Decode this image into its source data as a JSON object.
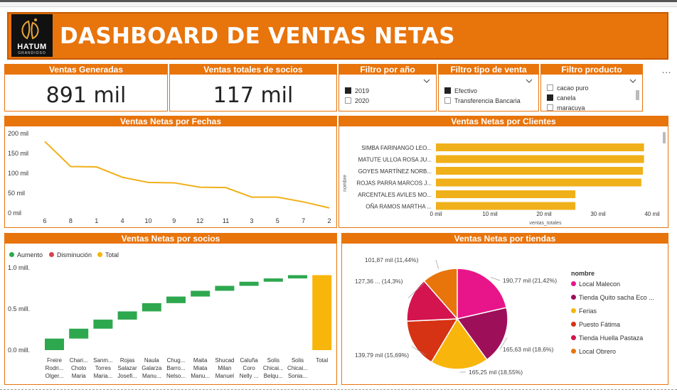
{
  "header": {
    "title": "DASHBOARD DE VENTAS NETAS",
    "logo_text": "HATUM",
    "logo_sub": "GRANDIOSO",
    "more_icon": "…"
  },
  "kpis": [
    {
      "label": "Ventas Generadas",
      "value": "891 mil"
    },
    {
      "label": "Ventas totales de socios",
      "value": "117 mil"
    }
  ],
  "filters": {
    "year": {
      "label": "Filtro por año",
      "options": [
        {
          "text": "2019",
          "checked": true
        },
        {
          "text": "2020",
          "checked": false
        }
      ]
    },
    "sale_type": {
      "label": "Filtro tipo de venta",
      "options": [
        {
          "text": "Efectivo",
          "checked": true
        },
        {
          "text": "Transferencia Bancaria",
          "checked": false
        }
      ]
    },
    "product": {
      "label": "Filtro producto",
      "options": [
        {
          "text": "cacao puro",
          "checked": false
        },
        {
          "text": "canela",
          "checked": true
        },
        {
          "text": "maracuya",
          "checked": false
        }
      ]
    }
  },
  "colors": {
    "accent": "#e8740c",
    "line": "#f0b01a",
    "increase": "#2ea84f",
    "decrease": "#d9414d",
    "total": "#f8b50c"
  },
  "charts": {
    "fechas": {
      "title": "Ventas Netas por Fechas"
    },
    "clientes": {
      "title": "Ventas Netas por Clientes"
    },
    "socios": {
      "title": "Ventas Netas por socios"
    },
    "tiendas": {
      "title": "Ventas Netas por tiendas"
    }
  },
  "chart_data": [
    {
      "type": "line",
      "title": "Ventas Netas por Fechas",
      "categories": [
        "6",
        "8",
        "1",
        "4",
        "10",
        "9",
        "12",
        "11",
        "3",
        "5",
        "7",
        "2"
      ],
      "values": [
        180,
        117,
        116,
        90,
        77,
        76,
        65,
        64,
        40,
        40,
        28,
        13
      ],
      "ylim": [
        0,
        200
      ],
      "yticks": [
        "200 mil",
        "150 mil",
        "100 mil",
        "50 mil",
        "0 mil"
      ],
      "grid": false
    },
    {
      "type": "bar",
      "orientation": "horizontal",
      "title": "Ventas Netas por Clientes",
      "categories": [
        "SIMBA FARINANGO LEO...",
        "MATUTE ULLOA ROSA JU...",
        "GOYES MARTÍNEZ NORB...",
        "ROJAS PARRA MARCOS J...",
        "ARCENTALES AVILES MO...",
        "OÑA RAMOS MARTHA ..."
      ],
      "values": [
        38.5,
        38.5,
        38.3,
        38.0,
        25.8,
        25.8
      ],
      "xticks": [
        "0 mil",
        "10 mil",
        "20 mil",
        "30 mil",
        "40 mil"
      ],
      "xlim": [
        0,
        40
      ],
      "xlabel": "ventas_totales",
      "ylabel": "nombre"
    },
    {
      "type": "bar",
      "subtype": "waterfall",
      "title": "Ventas Netas por socios",
      "legend": [
        "Aumento",
        "Disminución",
        "Total"
      ],
      "categories": [
        [
          "Freire",
          "Rodri...",
          "Olger..."
        ],
        [
          "Chari...",
          "Choto",
          "Maria"
        ],
        [
          "Sanm...",
          "Torres",
          "Maria..."
        ],
        [
          "Rojas",
          "Salazar",
          "Josefi..."
        ],
        [
          "Naula",
          "Galarza",
          "Manu..."
        ],
        [
          "Chug...",
          "Barro...",
          "Nelso..."
        ],
        [
          "Maita",
          "Miata",
          "Manu..."
        ],
        [
          "Shucad",
          "Milan",
          "Manuel"
        ],
        [
          "Caluña",
          "Coro",
          "Nelly ..."
        ],
        [
          "Solis",
          "Chicai...",
          "Belqu..."
        ],
        [
          "Solis",
          "Chicai...",
          "Sonia..."
        ],
        [
          "Total"
        ]
      ],
      "steps": [
        0.14,
        0.12,
        0.11,
        0.1,
        0.1,
        0.08,
        0.07,
        0.06,
        0.05,
        0.04,
        0.04
      ],
      "total": 0.91,
      "yticks": [
        "1.0 mill.",
        "0.5 mill.",
        "0.0 mill."
      ],
      "ylim": [
        0,
        1.0
      ]
    },
    {
      "type": "pie",
      "title": "Ventas Netas por tiendas",
      "legend_title": "nombre",
      "series": [
        {
          "name": "Local Malecon",
          "value": 190.77,
          "label": "190,77 mil (21,42%)",
          "color": "#e8158a"
        },
        {
          "name": "Tienda Quito sacha Eco ...",
          "value": 165.63,
          "label": "165,63 mil (18,6%)",
          "color": "#9e0f5a"
        },
        {
          "name": "Ferias",
          "value": 165.25,
          "label": "165,25 mil (18,55%)",
          "color": "#f8b50c"
        },
        {
          "name": "Puesto Fátima",
          "value": 139.79,
          "label": "139,79 mil (15,69%)",
          "color": "#d63214"
        },
        {
          "name": "Tienda Huella Pastaza",
          "value": 127.36,
          "label": "127,36 ... (14,3%)",
          "color": "#d4144e"
        },
        {
          "name": "Local Obrero",
          "value": 101.87,
          "label": "101,87 mil (11,44%)",
          "color": "#e8740c"
        }
      ]
    }
  ]
}
